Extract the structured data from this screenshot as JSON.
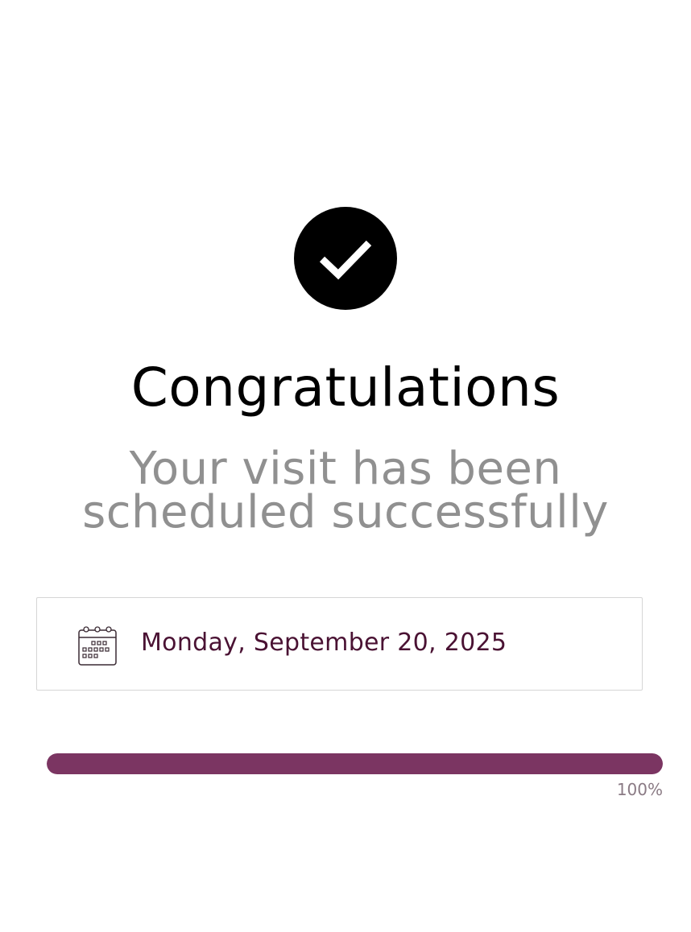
{
  "confirmation": {
    "icon": "checkmark-icon",
    "title": "Congratulations",
    "subtitle_line1": "Your visit has been",
    "subtitle_line2": "scheduled successfully"
  },
  "appointment": {
    "icon": "calendar-icon",
    "date": "Monday, September 20, 2025"
  },
  "progress": {
    "percent": 100,
    "label": "100%"
  },
  "colors": {
    "accent": "#7b3562",
    "date_text": "#4a1233",
    "subtitle": "#909090"
  }
}
